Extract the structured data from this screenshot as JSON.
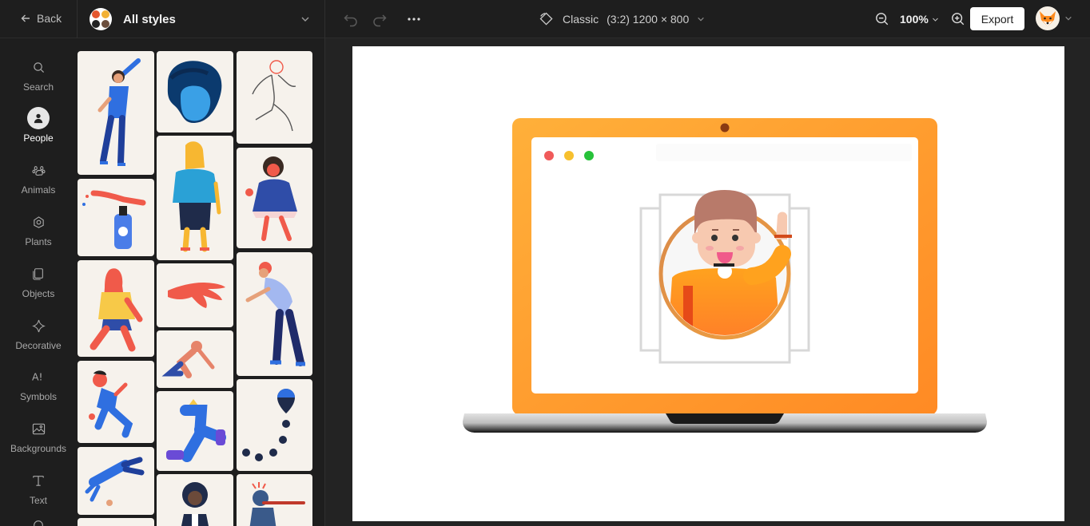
{
  "topbar": {
    "back_label": "Back",
    "style_title": "All styles",
    "canvas_label": "Classic",
    "canvas_ratio": "(3:2) 1200 × 800",
    "zoom": "100%",
    "export_label": "Export"
  },
  "nav": {
    "items": [
      {
        "label": "Search",
        "icon": "search-icon"
      },
      {
        "label": "People",
        "icon": "person-icon",
        "active": true
      },
      {
        "label": "Animals",
        "icon": "paw-icon"
      },
      {
        "label": "Plants",
        "icon": "plant-icon"
      },
      {
        "label": "Objects",
        "icon": "objects-icon"
      },
      {
        "label": "Decorative",
        "icon": "sparkle-icon"
      },
      {
        "label": "Symbols",
        "icon": "symbols-icon"
      },
      {
        "label": "Backgrounds",
        "icon": "image-icon"
      },
      {
        "label": "Text",
        "icon": "text-icon"
      }
    ]
  },
  "colors": {
    "accent_orange": "#ff9a2e",
    "illustration_blue": "#2f6fe0",
    "card_bg": "#f6f2ec"
  }
}
